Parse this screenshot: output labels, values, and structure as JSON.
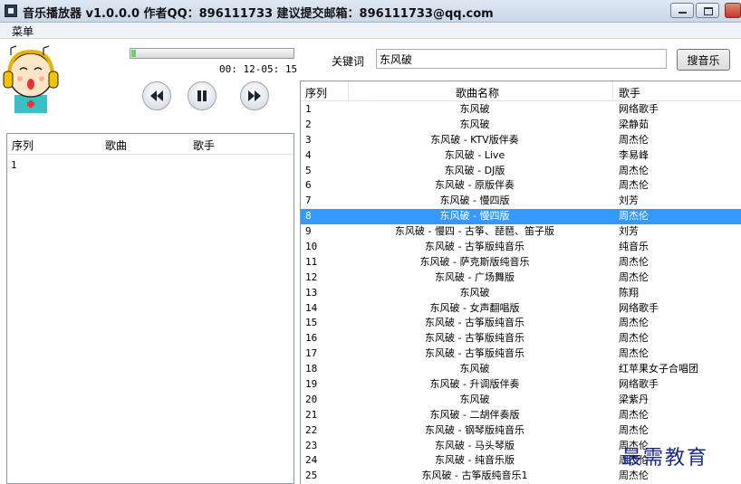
{
  "window": {
    "title": "音乐播放器 v1.0.0.0   作者QQ：896111733 建议提交邮箱：896111733@qq.com",
    "accent": "#3399ff"
  },
  "menu": {
    "label": "菜单"
  },
  "player": {
    "time": "00: 12-05: 15",
    "progress_percent": 3,
    "controls": [
      "rewind-icon",
      "pause-icon",
      "fast-forward-icon"
    ]
  },
  "playlist": {
    "columns": [
      "序列",
      "歌曲",
      "歌手"
    ],
    "rows": [
      {
        "index": "1"
      }
    ]
  },
  "search": {
    "label": "关键词",
    "value": "东风破",
    "button": "搜音乐"
  },
  "results": {
    "columns": [
      "序列",
      "歌曲名称",
      "歌手"
    ],
    "selected_index": "8",
    "rows": [
      {
        "index": "1",
        "song": "东风破",
        "artist": "网络歌手"
      },
      {
        "index": "2",
        "song": "东风破",
        "artist": "梁静茹"
      },
      {
        "index": "3",
        "song": "东风破 - KTV版伴奏",
        "artist": "周杰伦"
      },
      {
        "index": "4",
        "song": "东风破 - Live",
        "artist": "李易峰"
      },
      {
        "index": "5",
        "song": "东风破 - DJ版",
        "artist": "周杰伦"
      },
      {
        "index": "6",
        "song": "东风破 - 原版伴奏",
        "artist": "周杰伦"
      },
      {
        "index": "7",
        "song": "东风破 - 慢四版",
        "artist": "刘芳"
      },
      {
        "index": "8",
        "song": "东风破 - 慢四版",
        "artist": "周杰伦"
      },
      {
        "index": "9",
        "song": "东风破 - 慢四 - 古筝、琵琶、笛子版",
        "artist": "刘芳"
      },
      {
        "index": "10",
        "song": "东风破 - 古筝版纯音乐",
        "artist": "纯音乐"
      },
      {
        "index": "11",
        "song": "东风破 - 萨克斯版纯音乐",
        "artist": "周杰伦"
      },
      {
        "index": "12",
        "song": "东风破 - 广场舞版",
        "artist": "周杰伦"
      },
      {
        "index": "13",
        "song": "东风破",
        "artist": "陈翔"
      },
      {
        "index": "14",
        "song": "东风破 - 女声翻唱版",
        "artist": "网络歌手"
      },
      {
        "index": "15",
        "song": "东风破 - 古筝版纯音乐",
        "artist": "周杰伦"
      },
      {
        "index": "16",
        "song": "东风破 - 古筝版纯音乐",
        "artist": "周杰伦"
      },
      {
        "index": "17",
        "song": "东风破 - 古筝版纯音乐",
        "artist": "周杰伦"
      },
      {
        "index": "18",
        "song": "东风破",
        "artist": "红苹果女子合唱团"
      },
      {
        "index": "19",
        "song": "东风破 - 升调版伴奏",
        "artist": "网络歌手"
      },
      {
        "index": "20",
        "song": "东风破",
        "artist": "梁紫丹"
      },
      {
        "index": "21",
        "song": "东风破 - 二胡伴奏版",
        "artist": "周杰伦"
      },
      {
        "index": "22",
        "song": "东风破 - 钢琴版纯音乐",
        "artist": "周杰伦"
      },
      {
        "index": "23",
        "song": "东风破 - 马头琴版",
        "artist": "周杰伦"
      },
      {
        "index": "24",
        "song": "东风破 - 纯音乐版",
        "artist": "周杰伦"
      },
      {
        "index": "25",
        "song": "东风破 - 古筝版纯音乐1",
        "artist": "周杰伦"
      }
    ]
  },
  "watermark": "最需教育"
}
